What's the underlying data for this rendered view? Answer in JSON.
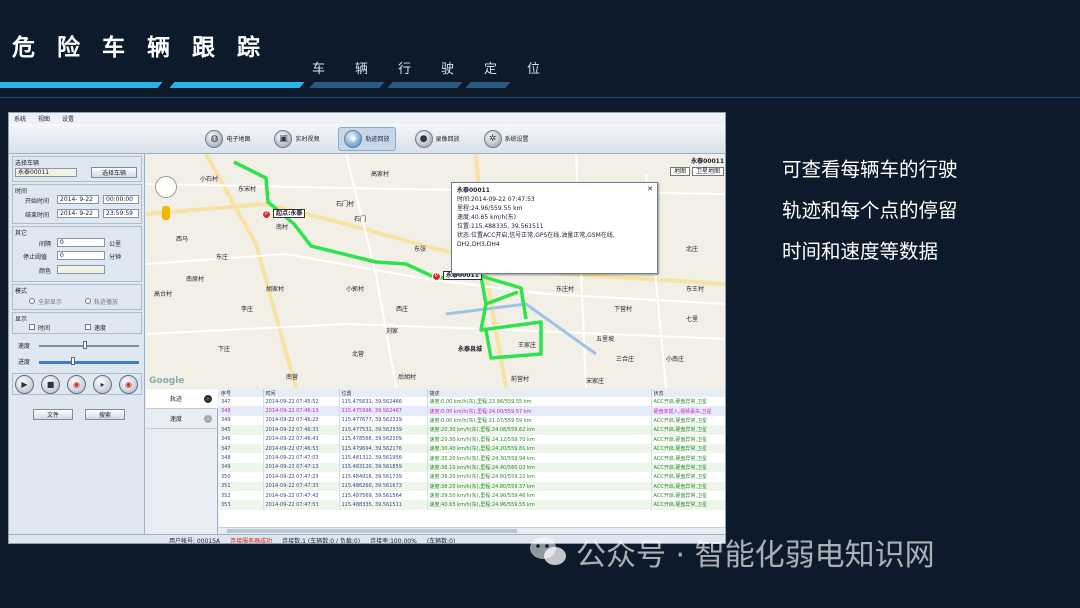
{
  "slide": {
    "title": "危险车辆跟踪",
    "subtitle": "车辆行驶定位",
    "description": [
      "可查看每辆车的行驶",
      "轨迹和每个点的停留",
      "时间和速度等数据"
    ],
    "watermark": "公众号 · 智能化弱电知识网",
    "colors": {
      "background": "#0d1a2b",
      "accent": "#2bb3e6"
    }
  },
  "app": {
    "menu": [
      "系统",
      "视图",
      "设置"
    ],
    "toolbar": [
      {
        "label": "电子地图",
        "icon": "map-icon"
      },
      {
        "label": "实时视频",
        "icon": "video-icon"
      },
      {
        "label": "轨迹回放",
        "icon": "track-icon",
        "active": true
      },
      {
        "label": "录像回放",
        "icon": "record-icon"
      },
      {
        "label": "系统设置",
        "icon": "gear-icon"
      }
    ],
    "left": {
      "vehicle_group": "选择车辆",
      "vehicle_value": "永泰00011",
      "select_button": "选择车辆",
      "time_group": "时间",
      "start_label": "开始时间",
      "start_date": "2014- 9-22",
      "start_time": "00:00:00",
      "end_label": "结束时间",
      "end_date": "2014- 9-22",
      "end_time": "23:59:59",
      "other_group": "其它",
      "interval_label": "间隔",
      "interval_value": "0",
      "interval_unit": "公里",
      "stop_label": "停止阈值",
      "stop_value": "0",
      "stop_unit": "分钟",
      "color_label": "颜色",
      "mode_group": "模式",
      "mode_1": "全部显示",
      "mode_2": "轨迹播放",
      "show_group": "显示",
      "show_time": "时间",
      "show_speed": "速度",
      "speed_label": "速度",
      "progress_label": "进度",
      "file_button": "文件",
      "search_button": "搜索"
    },
    "map": {
      "top_right_label": "永泰00011",
      "map_button": "地图",
      "satellite_button": "卫星地图",
      "start_marker": "起点:永泰",
      "current_marker": "永泰00011",
      "popup": {
        "title": "永泰00011",
        "lines": [
          "时间:2014-09-22 07:47:53",
          "里程:24.96/559.55 km",
          "速度:40.65 km/h(东)",
          "位置:115.488335, 39.561511",
          "状态:位置ACC开启,信号正常,GPS在线,油量正常,GSM在线,",
          "DH2,DH3,DH4"
        ]
      },
      "places": [
        "东宋村",
        "南村",
        "石门村",
        "高家村",
        "小石村",
        "西马",
        "东庄",
        "南原村",
        "高台村",
        "胡家村",
        "小郭村",
        "石门",
        "李庄",
        "西庄",
        "东张",
        "下庄",
        "刘家",
        "北营",
        "南营",
        "后胡村",
        "王家庄",
        "永泰县城",
        "前营村",
        "东庄村",
        "下营村",
        "北庄",
        "五里坡",
        "三合庄",
        "小南庄",
        "宋家庄",
        "七里",
        "东王村"
      ],
      "watermark": "Google"
    },
    "lower_tabs": [
      {
        "label": "轨迹",
        "active": true
      },
      {
        "label": "速度",
        "active": false
      }
    ],
    "table": {
      "headers": [
        "序号",
        "时间",
        "位置",
        "描述",
        "状态"
      ],
      "rows": [
        [
          "347",
          "2014-09-22 07:45:52",
          "115.475631, 39.562466",
          "速度:0.00 km/h(东),里程:23.96/559.55 km",
          "ACC开启,硬盘异常,卫星"
        ],
        [
          "348",
          "2014-09-22 07:46:13",
          "115.475996, 39.562467",
          "速度:0.00 km/h(东),里程:24.00/559.57 km",
          "硬盘未插入,视频丢失,卫星"
        ],
        [
          "349",
          "2014-09-22 07:46:23",
          "115.477677, 39.562319",
          "速度:0.00 km/h(东),里程:21.07/559.59 km",
          "ACC开启,硬盘异常,卫星"
        ],
        [
          "345",
          "2014-09-22 07:46:33",
          "115.477531, 39.562339",
          "速度:20.30 km/h(东),里程:24.08/559.62 km",
          "ACC开启,硬盘异常,卫星"
        ],
        [
          "346",
          "2014-09-22 07:46:43",
          "115.478566, 39.562309",
          "速度:20.30 km/h(东),里程:24.12/559.70 km",
          "ACC开启,硬盘异常,卫星"
        ],
        [
          "347",
          "2014-09-22 07:46:53",
          "115.479694, 39.562176",
          "速度:30.40 km/h(东),里程:24.20/559.81 km",
          "ACC开启,硬盘异常,卫星"
        ],
        [
          "348",
          "2014-09-22 07:47:03",
          "115.481312, 39.561956",
          "速度:35.20 km/h(东),里程:24.30/559.94 km",
          "ACC开启,硬盘异常,卫星"
        ],
        [
          "349",
          "2014-09-22 07:47:13",
          "115.483120, 39.561859",
          "速度:36.10 km/h(东),里程:24.40/560.02 km",
          "ACC开启,硬盘异常,卫星"
        ],
        [
          "350",
          "2014-09-22 07:47:23",
          "115.484916, 39.561739",
          "速度:36.20 km/h(东),里程:24.60/559.22 km",
          "ACC开启,硬盘异常,卫星"
        ],
        [
          "351",
          "2014-09-22 07:47:33",
          "115.486260, 39.561673",
          "速度:38.20 km/h(东),里程:24.80/559.37 km",
          "ACC开启,硬盘异常,卫星"
        ],
        [
          "352",
          "2014-09-22 07:47:43",
          "115.487569, 39.561564",
          "速度:39.50 km/h(东),里程:24.90/559.46 km",
          "ACC开启,硬盘异常,卫星"
        ],
        [
          "353",
          "2014-09-22 07:47:53",
          "115.488335, 39.561511",
          "速度:40.65 km/h(东),里程:24.96/559.55 km",
          "ACC开启,硬盘异常,卫星"
        ]
      ]
    },
    "status": {
      "items": [
        "用户帐号: 00015A",
        "连接服务器成功",
        "连接数:1 (车辆数:0 / 负载:0)",
        "连接率:100.00%",
        "(车辆数:0)"
      ]
    }
  }
}
